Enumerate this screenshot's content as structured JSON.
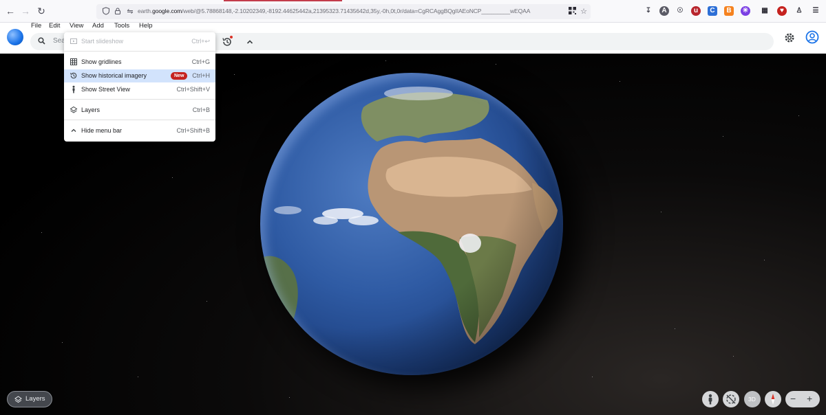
{
  "browser": {
    "tab_accent_color": "#c33c4b",
    "url_prefix": "earth.",
    "url_host": "google.com",
    "url_path": "/web/@5.78868148,-2.10202349,-8192.44625442a,21395323.71435642d,35y,-0h,0t,0r/data=CgRCAggBQgIIAEoNCP_________wEQAA"
  },
  "app": {
    "menu": [
      "File",
      "Edit",
      "View",
      "Add",
      "Tools",
      "Help"
    ],
    "search_placeholder": "Sea",
    "brand_color": "#1a73e8"
  },
  "view_menu": {
    "items": [
      {
        "label": "Start slideshow",
        "shortcut": "Ctrl+↩",
        "icon": "slideshow-icon",
        "disabled": true
      },
      {
        "label": "Show gridlines",
        "shortcut": "Ctrl+G",
        "icon": "grid-icon"
      },
      {
        "label": "Show historical imagery",
        "shortcut": "Ctrl+H",
        "icon": "history-icon",
        "badge": "New",
        "selected": true
      },
      {
        "label": "Show Street View",
        "shortcut": "Ctrl+Shift+V",
        "icon": "pegman-icon"
      },
      {
        "label": "Layers",
        "shortcut": "Ctrl+B",
        "icon": "layers-icon"
      },
      {
        "label": "Hide menu bar",
        "shortcut": "Ctrl+Shift+B",
        "icon": "chevron-up-icon"
      }
    ],
    "badge_color": "#c5221f"
  },
  "bottom": {
    "layers_label": "Layers",
    "mode_3d_label": "3D"
  }
}
